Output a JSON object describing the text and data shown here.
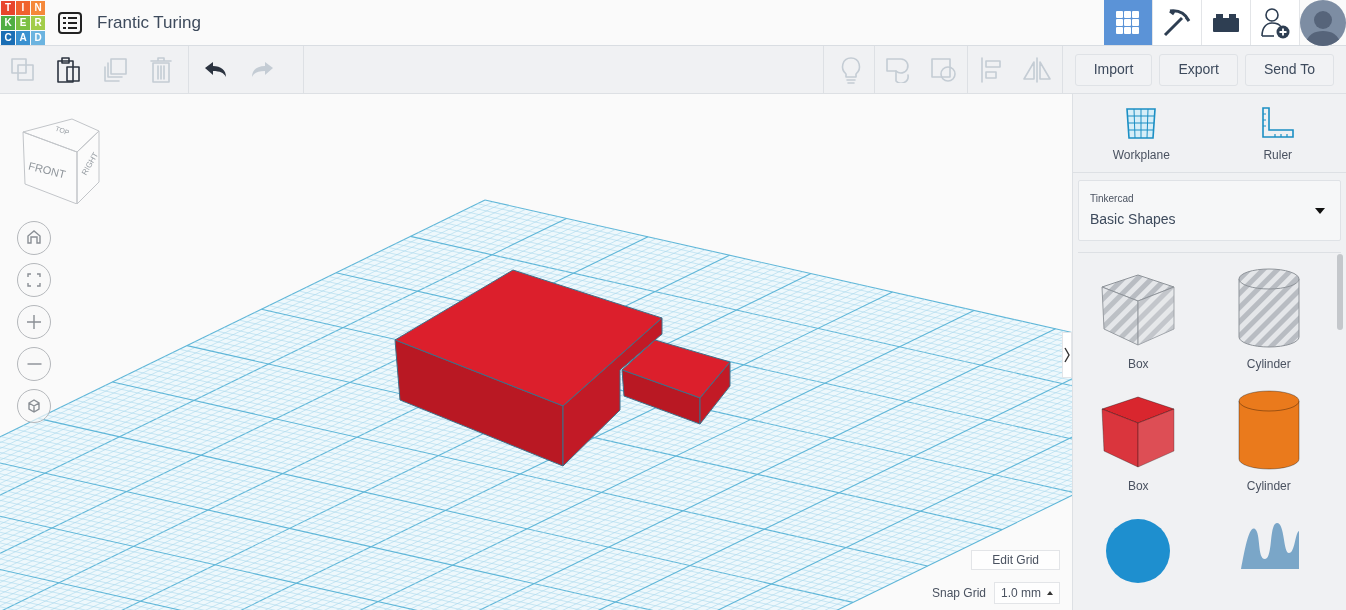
{
  "logo": {
    "letters": [
      {
        "char": "T",
        "color": "#e8452c"
      },
      {
        "char": "I",
        "color": "#f0622e"
      },
      {
        "char": "N",
        "color": "#f5883a"
      },
      {
        "char": "K",
        "color": "#4fae43"
      },
      {
        "char": "E",
        "color": "#7bc043"
      },
      {
        "char": "R",
        "color": "#a2cd4a"
      },
      {
        "char": "C",
        "color": "#1a6eb5"
      },
      {
        "char": "A",
        "color": "#3a91d0"
      },
      {
        "char": "D",
        "color": "#6cb4e0"
      }
    ]
  },
  "project_title": "Frantic Turing",
  "header_tabs": [
    {
      "kind": "grid",
      "selected": true
    },
    {
      "kind": "pickaxe",
      "selected": false
    },
    {
      "kind": "brick",
      "selected": false
    },
    {
      "kind": "add-user",
      "selected": false
    }
  ],
  "toolbar": [
    {
      "kind": "copy",
      "disabled": true
    },
    {
      "kind": "paste",
      "disabled": false
    },
    {
      "kind": "duplicate",
      "disabled": true
    },
    {
      "kind": "delete",
      "disabled": true
    },
    {
      "kind": "undo",
      "disabled": false
    },
    {
      "kind": "redo",
      "disabled": true
    },
    {
      "kind": "bulb",
      "disabled": true
    },
    {
      "kind": "group",
      "disabled": true
    },
    {
      "kind": "ungroup",
      "disabled": true
    },
    {
      "kind": "align",
      "disabled": true
    },
    {
      "kind": "mirror",
      "disabled": true
    }
  ],
  "actions": [
    "Import",
    "Export",
    "Send To"
  ],
  "view_cube": {
    "top": "TOP",
    "front": "FRONT",
    "right": "RIGHT"
  },
  "view_controls": [
    {
      "kind": "home"
    },
    {
      "kind": "fit"
    },
    {
      "kind": "zoom-in"
    },
    {
      "kind": "zoom-out"
    },
    {
      "kind": "perspective"
    }
  ],
  "panel": {
    "tools": [
      {
        "kind": "workplane",
        "label": "Workplane"
      },
      {
        "kind": "ruler",
        "label": "Ruler"
      }
    ],
    "library": {
      "label": "Tinkercad",
      "value": "Basic Shapes"
    },
    "shapes": [
      {
        "kind": "box",
        "label": "Box",
        "color": "#b8bcc2",
        "hole": true
      },
      {
        "kind": "cylinder",
        "label": "Cylinder",
        "color": "#b8bcc2",
        "hole": true
      },
      {
        "kind": "box",
        "label": "Box",
        "color": "#d9262e",
        "hole": false
      },
      {
        "kind": "cylinder",
        "label": "Cylinder",
        "color": "#ea7a1c",
        "hole": false
      },
      {
        "kind": "sphere",
        "color": "#1e8fcf",
        "hole": false
      },
      {
        "kind": "scribble",
        "color": "#7aa6c8",
        "hole": false
      }
    ]
  },
  "grid_controls": {
    "edit": "Edit Grid",
    "snap_label": "Snap Grid",
    "snap_value": "1.0 mm"
  }
}
